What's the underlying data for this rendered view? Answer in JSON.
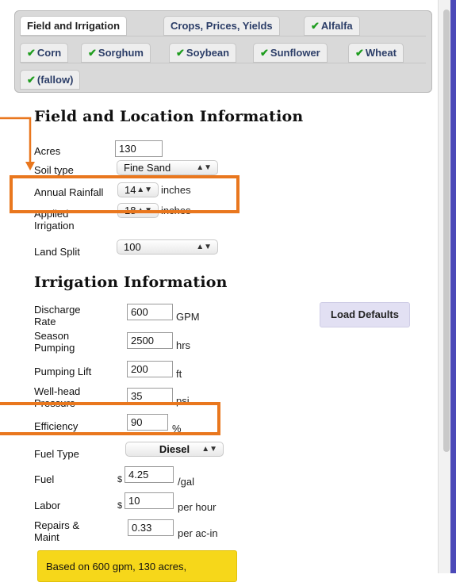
{
  "tabs": {
    "row1": [
      {
        "label": "Field and Irrigation",
        "checked": false,
        "active": true
      },
      {
        "label": "Crops, Prices, Yields",
        "checked": false,
        "active": false
      },
      {
        "label": "Alfalfa",
        "checked": true,
        "active": false
      }
    ],
    "row2": [
      {
        "label": "Corn",
        "checked": true
      },
      {
        "label": "Sorghum",
        "checked": true
      },
      {
        "label": "Soybean",
        "checked": true
      },
      {
        "label": "Sunflower",
        "checked": true
      },
      {
        "label": "Wheat",
        "checked": true
      }
    ],
    "row3": [
      {
        "label": "(fallow)",
        "checked": true
      }
    ],
    "check_glyph": "✔"
  },
  "field_section": {
    "title": "Field and Location Information",
    "acres": {
      "label": "Acres",
      "value": "130"
    },
    "soil_type": {
      "label": "Soil type",
      "value": "Fine Sand"
    },
    "annual_rainfall": {
      "label": "Annual Rainfall",
      "value": "14",
      "unit": "inches"
    },
    "applied_irrigation": {
      "label_line1": "Applied",
      "label_line2": "Irrigation",
      "value": "18",
      "unit": "inches"
    },
    "land_split": {
      "label": "Land Split",
      "value": "100"
    }
  },
  "irrigation_section": {
    "title": "Irrigation Information",
    "load_defaults": "Load Defaults",
    "discharge_rate": {
      "label_line1": "Discharge",
      "label_line2": "Rate",
      "value": "600",
      "unit": "GPM"
    },
    "season_pumping": {
      "label_line1": "Season",
      "label_line2": "Pumping",
      "value": "2500",
      "unit": "hrs"
    },
    "pumping_lift": {
      "label": "Pumping Lift",
      "value": "200",
      "unit": "ft"
    },
    "wellhead_pressure": {
      "label_line1": "Well-head",
      "label_line2": "Pressure",
      "value": "35",
      "unit": "psi"
    },
    "efficiency": {
      "label": "Efficiency",
      "value": "90",
      "unit": "%"
    },
    "fuel_type": {
      "label": "Fuel Type",
      "value": "Diesel"
    },
    "fuel": {
      "label": "Fuel",
      "prefix": "$",
      "value": "4.25",
      "unit": "/gal"
    },
    "labor": {
      "label": "Labor",
      "prefix": "$",
      "value": "10",
      "unit": "per hour"
    },
    "repairs": {
      "label_line1": "Repairs &",
      "label_line2": "Maint",
      "value": "0.33",
      "unit": "per ac-in"
    }
  },
  "notice": "Based on 600 gpm, 130 acres,",
  "colors": {
    "highlight": "#e9771e",
    "tab_text": "#2c3e68",
    "check": "#1f9d1f",
    "notice_bg": "#f6d71a"
  }
}
